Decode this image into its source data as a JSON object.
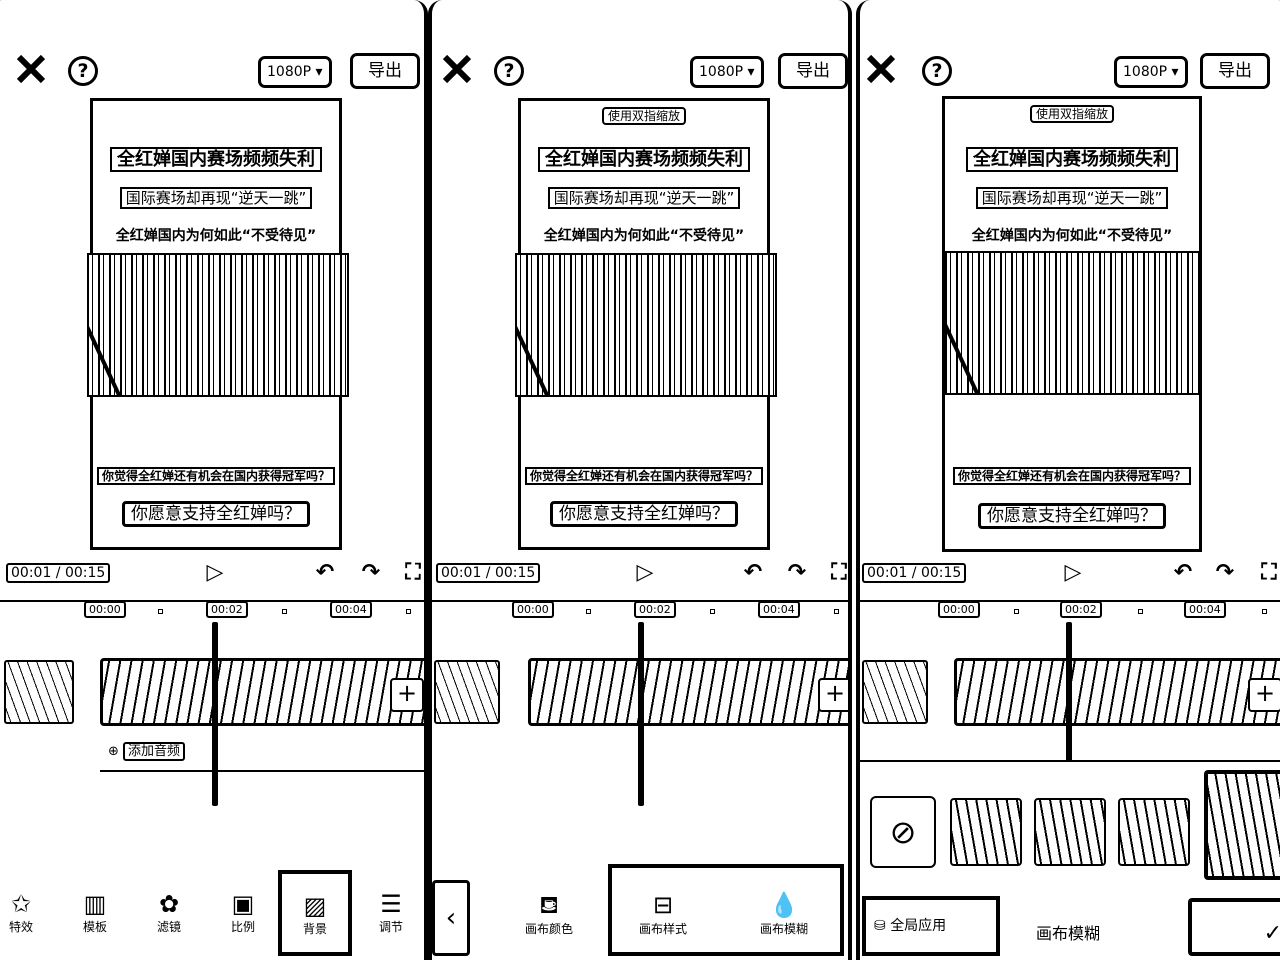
{
  "toolbar": {
    "resolution": "1080P",
    "export_label": "导出"
  },
  "canvas": {
    "pinch_hint": "使用双指缩放",
    "title": "全红婵国内赛场频频失利",
    "subtitle": "国际赛场却再现“逆天一跳”",
    "question": "全红婵国内为何如此“不受待见”",
    "bottom_question": "你觉得全红婵还有机会在国内获得冠军吗？",
    "support_question": "你愿意支持全红婵吗？"
  },
  "player": {
    "time": "00:01 / 00:15"
  },
  "timeline": {
    "ticks": [
      "00:00",
      "00:02",
      "00:04"
    ],
    "add_audio_label": "添加音频"
  },
  "panel1": {
    "tools": [
      {
        "label": "特效",
        "icon": "star-icon"
      },
      {
        "label": "模板",
        "icon": "template-icon"
      },
      {
        "label": "滤镜",
        "icon": "filter-icon"
      },
      {
        "label": "比例",
        "icon": "ratio-icon"
      },
      {
        "label": "背景",
        "icon": "background-icon"
      },
      {
        "label": "调节",
        "icon": "adjust-icon"
      }
    ],
    "selected_tool": "背景"
  },
  "panel2": {
    "options": [
      "画布颜色",
      "画布样式",
      "画布模糊"
    ]
  },
  "panel3": {
    "apply_all_label": "全局应用",
    "section_title": "画布模糊"
  },
  "colors": {
    "line": "#000000",
    "background": "#ffffff"
  }
}
